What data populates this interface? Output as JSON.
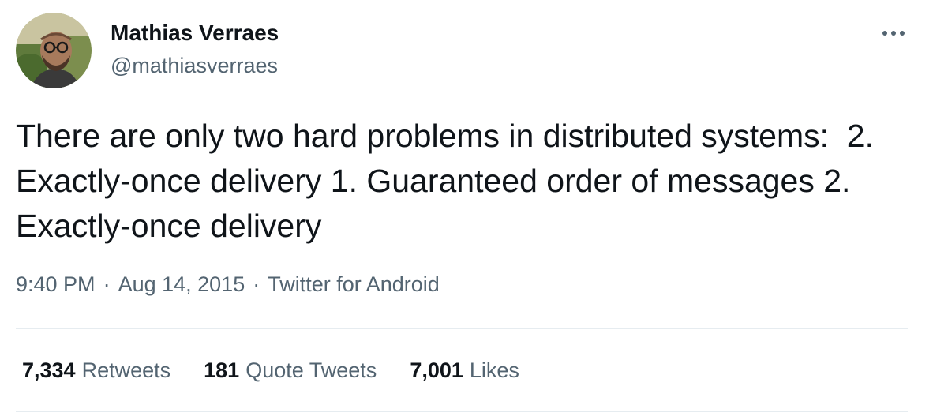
{
  "author": {
    "name": "Mathias Verraes",
    "handle": "@mathiasverraes"
  },
  "tweet": {
    "text": "There are only two hard problems in distributed systems:  2. Exactly-once delivery 1. Guaranteed order of messages 2. Exactly-once delivery"
  },
  "meta": {
    "time": "9:40 PM",
    "separator": "·",
    "date": "Aug 14, 2015",
    "source": "Twitter for Android"
  },
  "stats": {
    "retweets": {
      "count": "7,334",
      "label": "Retweets"
    },
    "quotes": {
      "count": "181",
      "label": "Quote Tweets"
    },
    "likes": {
      "count": "7,001",
      "label": "Likes"
    }
  },
  "icons": {
    "more": "more-horizontal-icon"
  },
  "colors": {
    "text_primary": "#0f1419",
    "text_secondary": "#536471",
    "divider": "#e6ecf0"
  }
}
